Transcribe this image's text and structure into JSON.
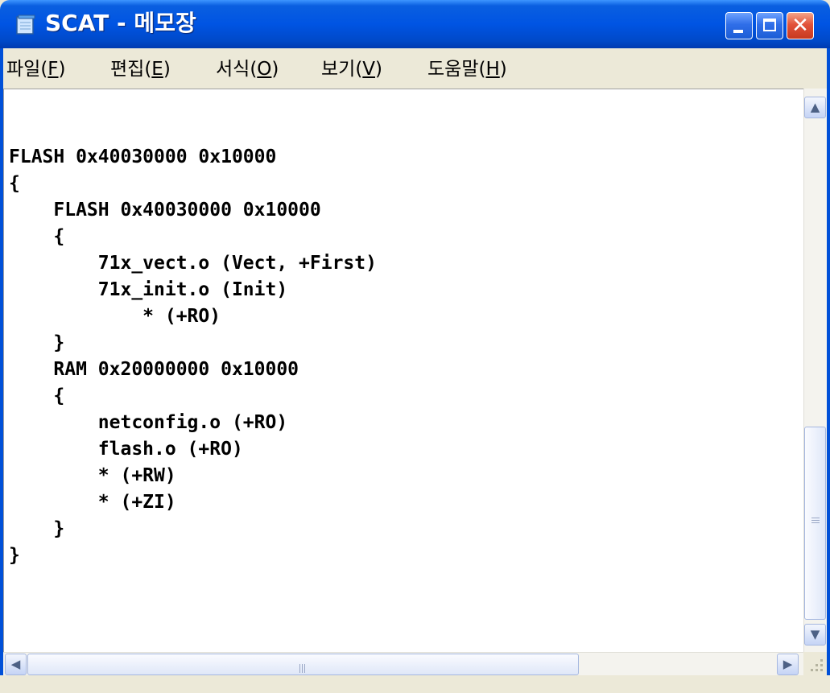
{
  "window": {
    "title": "SCAT - 메모장",
    "icon": "notepad-icon",
    "controls": {
      "minimize": "minimize-icon",
      "maximize": "maximize-icon",
      "close": "close-icon",
      "close_glyph": "✕"
    }
  },
  "menu": [
    {
      "label": "파일(",
      "key": "F",
      "suffix": ")"
    },
    {
      "label": "편집(",
      "key": "E",
      "suffix": ")"
    },
    {
      "label": "서식(",
      "key": "O",
      "suffix": ")"
    },
    {
      "label": "보기(",
      "key": "V",
      "suffix": ")"
    },
    {
      "label": "도움말(",
      "key": "H",
      "suffix": ")"
    }
  ],
  "editor": {
    "content": "FLASH 0x40030000 0x10000\n{\n    FLASH 0x40030000 0x10000\n    {\n        71x_vect.o (Vect, +First)\n        71x_init.o (Init)\n            * (+RO)\n    }\n    RAM 0x20000000 0x10000\n    {\n        netconfig.o (+RO)\n        flash.o (+RO)\n        * (+RW)\n        * (+ZI)\n    }\n}"
  },
  "scrollbars": {
    "up_glyph": "▲",
    "down_glyph": "▼",
    "left_glyph": "◀",
    "right_glyph": "▶"
  },
  "colors": {
    "titlebar": "#0054e3",
    "close_button": "#e2533a",
    "face": "#ece9d8"
  }
}
